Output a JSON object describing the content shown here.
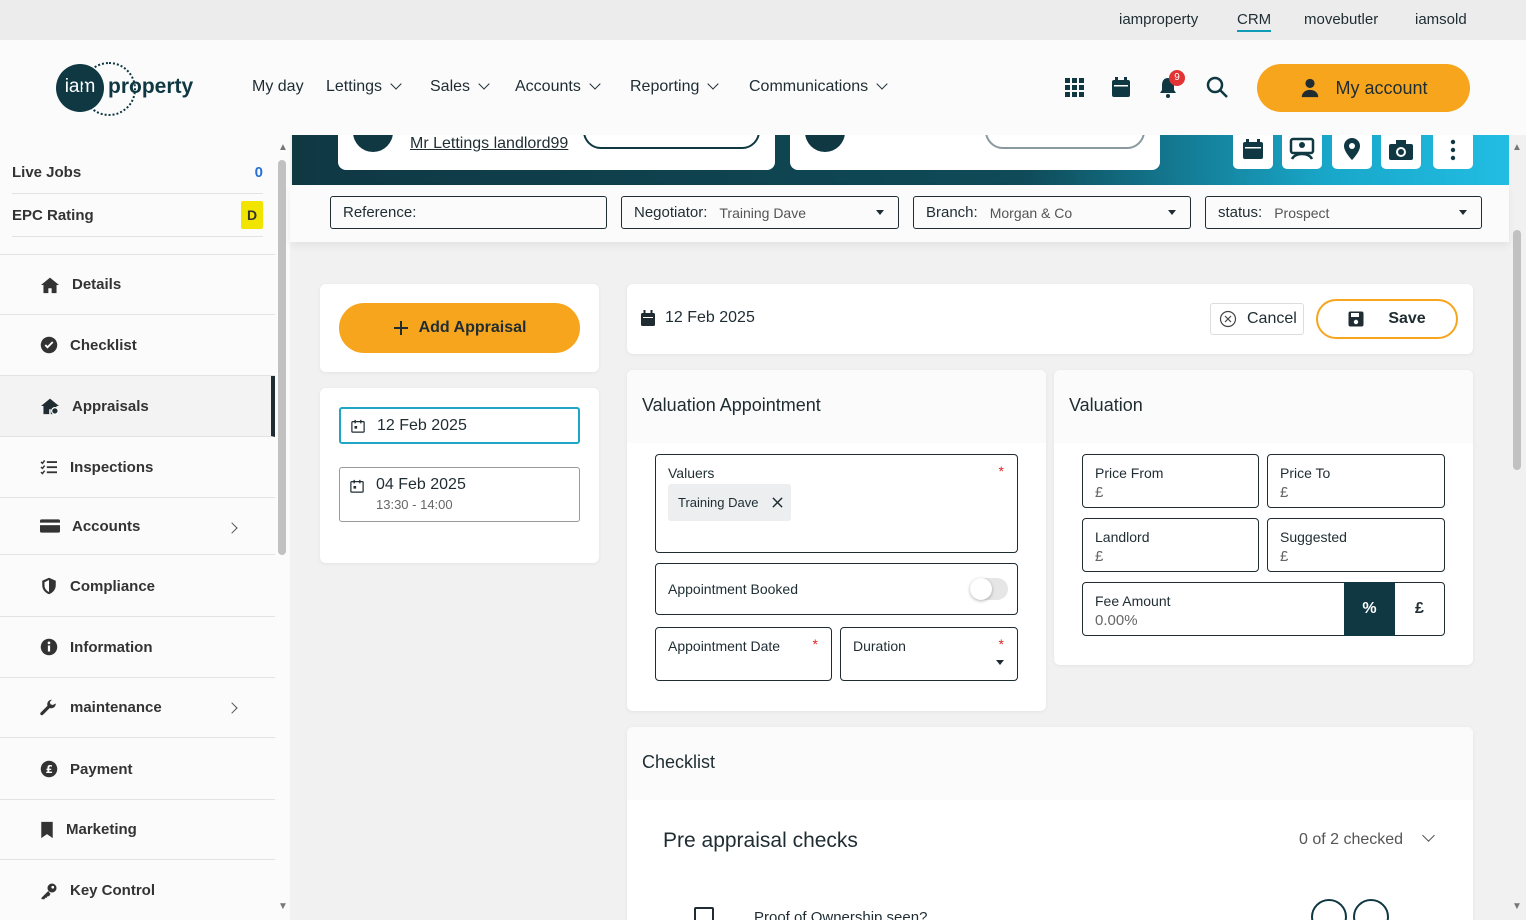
{
  "top_links": [
    {
      "label": "iamproperty",
      "active": false
    },
    {
      "label": "CRM",
      "active": true
    },
    {
      "label": "movebutler",
      "active": false
    },
    {
      "label": "iamsold",
      "active": false
    }
  ],
  "logo": {
    "circle_text": "iam",
    "word": "property"
  },
  "nav": [
    "My day",
    "Lettings",
    "Sales",
    "Accounts",
    "Reporting",
    "Communications"
  ],
  "header": {
    "notification_count": "9",
    "my_account_label": "My account"
  },
  "sidebar": {
    "live_jobs": {
      "label": "Live Jobs",
      "value": "0"
    },
    "epc": {
      "label": "EPC Rating",
      "value": "D"
    },
    "items": [
      {
        "label": "Details",
        "icon": "home-icon"
      },
      {
        "label": "Checklist",
        "icon": "check-circle-icon"
      },
      {
        "label": "Appraisals",
        "icon": "house-tag-icon",
        "active": true
      },
      {
        "label": "Inspections",
        "icon": "list-check-icon"
      },
      {
        "label": "Accounts",
        "icon": "card-icon",
        "has_arrow": true
      },
      {
        "label": "Compliance",
        "icon": "shield-icon"
      },
      {
        "label": "Information",
        "icon": "info-icon"
      },
      {
        "label": "maintenance",
        "icon": "wrench-icon",
        "has_arrow": true
      },
      {
        "label": "Payment",
        "icon": "pound-circle-icon"
      },
      {
        "label": "Marketing",
        "icon": "bookmark-icon"
      },
      {
        "label": "Key Control",
        "icon": "key-icon"
      }
    ]
  },
  "banner": {
    "landlord_link": "Mr Lettings landlord99"
  },
  "filters": {
    "reference": {
      "label": "Reference:",
      "value": ""
    },
    "negotiator": {
      "label": "Negotiator:",
      "value": "Training Dave"
    },
    "branch": {
      "label": "Branch:",
      "value": "Morgan & Co"
    },
    "status": {
      "label": "status:",
      "value": "Prospect"
    }
  },
  "appraisals": {
    "add_label": "Add Appraisal",
    "list": [
      {
        "date": "12 Feb 2025",
        "time": "",
        "selected": true
      },
      {
        "date": "04 Feb 2025",
        "time": "13:30 - 14:00",
        "selected": false
      }
    ]
  },
  "current": {
    "date": "12 Feb 2025",
    "cancel_label": "Cancel",
    "save_label": "Save"
  },
  "valuation_appointment": {
    "title": "Valuation Appointment",
    "valuers_label": "Valuers",
    "valuer_chip": "Training Dave",
    "booked_label": "Appointment Booked",
    "date_label": "Appointment Date",
    "duration_label": "Duration",
    "required_mark": "*"
  },
  "valuation": {
    "title": "Valuation",
    "price_from": {
      "label": "Price From",
      "value": "£"
    },
    "price_to": {
      "label": "Price To",
      "value": "£"
    },
    "landlord": {
      "label": "Landlord",
      "value": "£"
    },
    "suggested": {
      "label": "Suggested",
      "value": "£"
    },
    "fee": {
      "label": "Fee Amount",
      "value": "0.00%",
      "percent": "%",
      "pound": "£"
    }
  },
  "checklist": {
    "title": "Checklist",
    "group_title": "Pre appraisal checks",
    "count": "0 of 2 checked",
    "first_item": "Proof of Ownership seen?"
  },
  "colors": {
    "accent": "#f7a51d",
    "dark": "#0f3843",
    "teal": "#1fa6c4"
  }
}
